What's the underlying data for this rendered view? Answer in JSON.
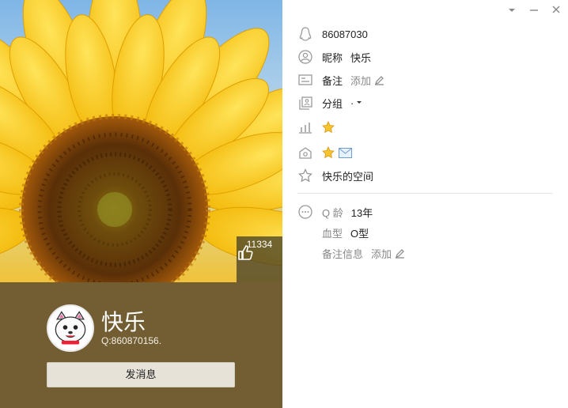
{
  "window": {
    "minimize_icon": "minimize-icon",
    "dropdown_icon": "dropdown-icon",
    "close_icon": "close-icon"
  },
  "profile": {
    "likes": "11334",
    "nickname": "快乐",
    "qq_line": "Q:860870156.",
    "send_button": "发消息"
  },
  "details": {
    "qq_number": "86087030",
    "nickname_label": "昵称",
    "nickname_value": "快乐",
    "remark_label": "备注",
    "remark_add": "添加",
    "group_label": "分组",
    "group_value": "·",
    "space_link": "快乐的空间",
    "age_label": "Q 龄",
    "age_value": "13年",
    "blood_label": "血型",
    "blood_value": "O型",
    "remark_info_label": "备注信息",
    "remark_info_add": "添加"
  },
  "colors": {
    "brown_panel": "#735e34",
    "accent_gray": "#888888"
  }
}
